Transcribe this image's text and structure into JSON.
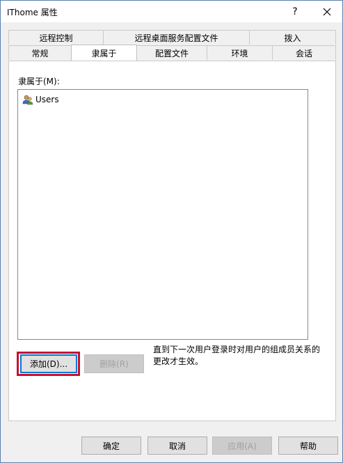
{
  "window": {
    "title": "IThome 属性",
    "help_label": "?",
    "close_label": "close"
  },
  "tabs": {
    "row1": [
      "远程控制",
      "远程桌面服务配置文件",
      "拨入"
    ],
    "row2": [
      "常规",
      "隶属于",
      "配置文件",
      "环境",
      "会话"
    ],
    "active": "隶属于"
  },
  "member_of": {
    "label": "隶属于(M):",
    "items": [
      {
        "name": "Users",
        "icon": "user-group-icon"
      }
    ]
  },
  "actions": {
    "add_label": "添加(D)...",
    "remove_label": "删除(R)",
    "note": "直到下一次用户登录时对用户的组成员关系的更改才生效。"
  },
  "footer": {
    "ok_label": "确定",
    "cancel_label": "取消",
    "apply_label": "应用(A)",
    "help_label": "帮助"
  },
  "colors": {
    "highlight": "#c8102e",
    "focus": "#0078d7"
  }
}
